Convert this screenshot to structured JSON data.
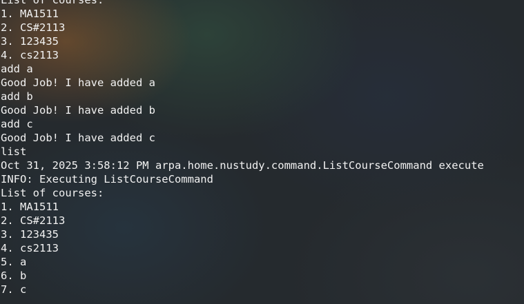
{
  "terminal": {
    "lines": [
      "List of courses:",
      "1. MA1511",
      "2. CS#2113",
      "3. 123435",
      "4. cs2113",
      "add a",
      "Good Job! I have added a",
      "add b",
      "Good Job! I have added b",
      "add c",
      "Good Job! I have added c",
      "list",
      "Oct 31, 2025 3:58:12 PM arpa.home.nustudy.command.ListCourseCommand execute",
      "INFO: Executing ListCourseCommand",
      "List of courses:",
      "1. MA1511",
      "2. CS#2113",
      "3. 123435",
      "4. cs2113",
      "5. a",
      "6. b",
      "7. c"
    ]
  }
}
